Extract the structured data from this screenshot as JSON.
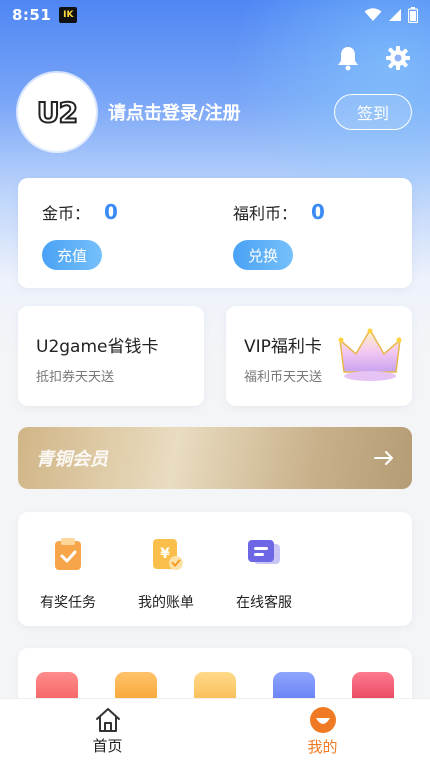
{
  "status_bar": {
    "time": "8:51",
    "app_badge": "IK"
  },
  "header": {
    "login_prompt": "请点击登录/注册",
    "signin_label": "签到",
    "avatar_text": "U2"
  },
  "wallet": {
    "coins_label": "金币：",
    "coins_value": "0",
    "recharge_label": "充值",
    "welfare_label": "福利币：",
    "welfare_value": "0",
    "exchange_label": "兑换"
  },
  "promo_cards": [
    {
      "title": "U2game省钱卡",
      "subtitle": "抵扣券天天送"
    },
    {
      "title": "VIP福利卡",
      "subtitle": "福利币天天送"
    }
  ],
  "membership": {
    "label": "青铜会员"
  },
  "services": [
    {
      "label": "有奖任务",
      "icon": "task-clipboard-icon"
    },
    {
      "label": "我的账单",
      "icon": "bill-icon"
    },
    {
      "label": "在线客服",
      "icon": "customer-service-icon"
    }
  ],
  "tabbar": {
    "home_label": "首页",
    "mine_label": "我的",
    "active_color": "#f07a24"
  },
  "colors": {
    "accent_blue": "#3b8cf2",
    "orange": "#f7a54a"
  }
}
